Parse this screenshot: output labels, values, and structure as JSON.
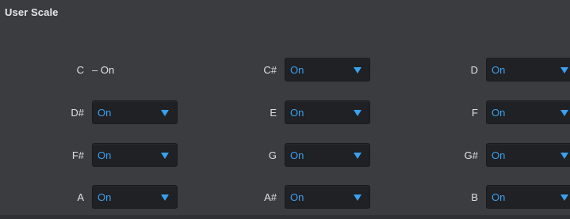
{
  "panel": {
    "title": "User Scale"
  },
  "notes": [
    {
      "label": "C",
      "static_text": "–  On",
      "value": null
    },
    {
      "label": "C#",
      "value": "On"
    },
    {
      "label": "D",
      "value": "On"
    },
    {
      "label": "D#",
      "value": "On"
    },
    {
      "label": "E",
      "value": "On"
    },
    {
      "label": "F",
      "value": "On"
    },
    {
      "label": "F#",
      "value": "On"
    },
    {
      "label": "G",
      "value": "On"
    },
    {
      "label": "G#",
      "value": "On"
    },
    {
      "label": "A",
      "value": "On"
    },
    {
      "label": "A#",
      "value": "On"
    },
    {
      "label": "B",
      "value": "On"
    }
  ],
  "icons": {
    "dropdown": "chevron-down-icon"
  },
  "colors": {
    "panel_bg": "#3a3c3f",
    "select_bg": "#1f2124",
    "accent": "#3aa0f0",
    "label": "#e0e0e0"
  }
}
